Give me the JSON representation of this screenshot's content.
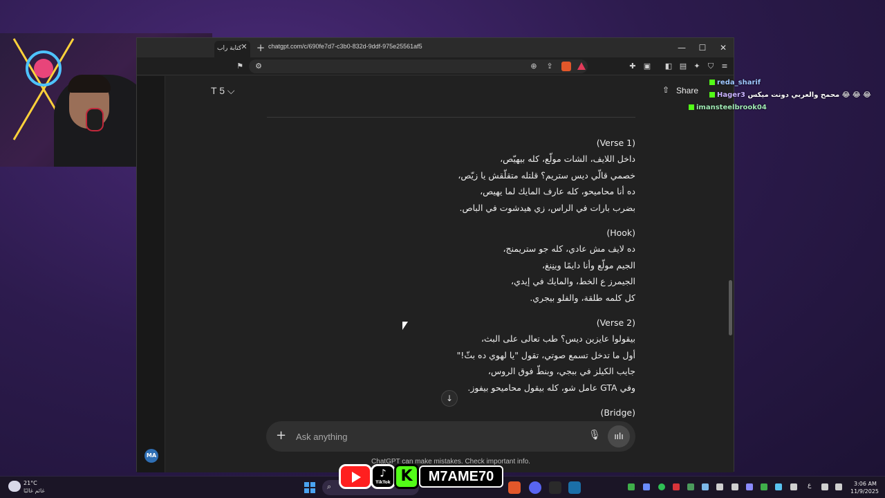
{
  "browser": {
    "tab_title": "كتابة راب",
    "tab_close": "✕",
    "new_tab": "+",
    "url": "chatgpt.com/c/690fe7d7-c3b0-832d-9ddf-975e25561af5",
    "window_controls": {
      "minimize": "—",
      "maximize": "☐",
      "close": "✕"
    }
  },
  "chatgpt": {
    "model_label": "T 5 ⌵",
    "share_label": "Share",
    "share_icon": "upload-icon",
    "user_initials": "MA",
    "composer_placeholder": "Ask anything",
    "disclaimer": "ChatGPT can make mistakes. Check important info.",
    "scroll_down_icon": "↓",
    "lyrics": [
      {
        "heading": "(Verse 1)",
        "lines": [
          "داخل اللايف، الشات مولّع، كله بيهيّص،",
          "خصمي قالّي ديس ستريم؟ قلتله متقلّقش يا زيّص،",
          "ده أنا محاميحو، كله عارف المايك لما يهيص،",
          "بضرب بارات في الراس، زي هيدشوت في الباص."
        ]
      },
      {
        "heading": "(Hook)",
        "lines": [
          "ده لايف مش عادي، كله جو ستريمنج،",
          "الجيم مولّع وأنا دايمًا وينِنغ،",
          "الجيمرز ع الخط، والمايك في إيدي،",
          "كل كلمه طلقة، والفلو بيجري."
        ]
      },
      {
        "heading": "(Verse 2)",
        "lines": [
          "بيقولوا عايزين ديس؟ طب تعالى على البث،",
          "أول ما تدخل تسمع صوتي، تقول \"يا لهوي ده بثّ!\"",
          "جايب الكيلز في ببجي، وبنطّ فوق الروس،",
          "وفي GTA عامل شو، كله بيقول محاميحو بيفوز."
        ]
      },
      {
        "heading": "(Bridge)",
        "lines": []
      }
    ]
  },
  "chat_overlay": [
    {
      "user": "reda_sharif",
      "text": "",
      "name_color": "#9fc8ff"
    },
    {
      "user": "Hager3",
      "text": "محمح والعربي دونت ميكس 😂 😂 😂",
      "name_color": "#c9b3ff"
    },
    {
      "user": "imansteelbrook04",
      "text": "",
      "name_color": "#9fe9b3"
    }
  ],
  "social_banner": {
    "tiktok_label": "TikTok",
    "kick_letter": "K",
    "handle": "M7AME70"
  },
  "taskbar": {
    "temperature": "21°C",
    "weather_desc": "غائم غالبًا",
    "time": "3:06 AM",
    "date": "11/9/2025",
    "language": "ع"
  }
}
